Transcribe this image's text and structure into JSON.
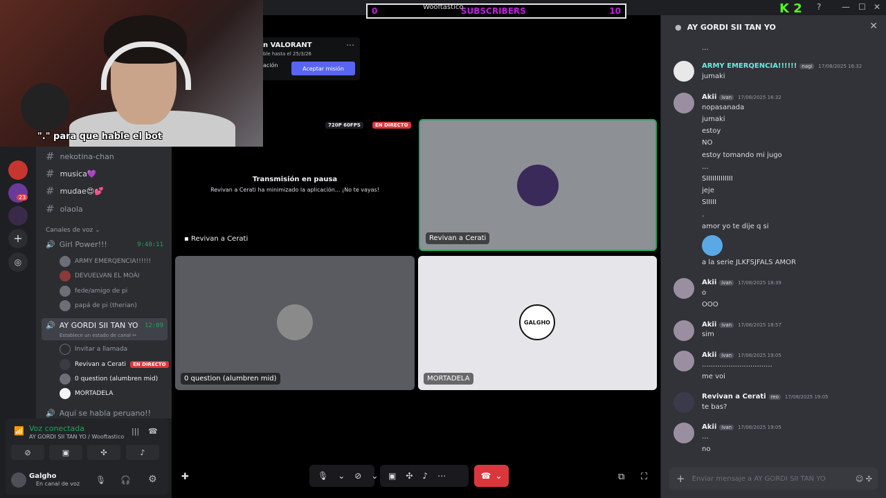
{
  "overlay": {
    "sub_left": "0",
    "sub_label": "SUBSCRIBERS",
    "sub_right": "10",
    "sub_who": "Wooftastico",
    "kick_count": "2",
    "cam_caption": "\".\" para que hable el bot"
  },
  "quest": {
    "title": "n VALORANT",
    "subtitle": "ble hasta el 25/3/26",
    "left_btn": "ación",
    "accept_btn": "Aceptar misión"
  },
  "channels": {
    "text": [
      {
        "label": "nekotina-chan"
      },
      {
        "label": "musica💜"
      },
      {
        "label": "mudae😍💕"
      },
      {
        "label": "olaola"
      }
    ],
    "voice_category": "Canales de voz ⌄",
    "voice1": {
      "name": "Girl Power!!!",
      "time": "9:48:11"
    },
    "voice1_users": [
      "ARMY EMERQENCIA!!!!!!",
      "DEVUELVAN EL MOÁI",
      "fede/amigo de pi",
      "papá de pi (therian)"
    ],
    "voice2": {
      "name": "AY GORDI SII TAN YO",
      "time": "12:09",
      "status": "Establece un estado de canal ✏"
    },
    "voice2_invite": "Invitar a llamada",
    "voice2_users": [
      "Revivan a Cerati",
      "0 question (alumbren mid)",
      "MORTADELA"
    ],
    "voice2_live": "EN DIRECTO",
    "voice3": "Aquí se habla peruano!!",
    "server_badge": "23"
  },
  "user_panel": {
    "voice_status": "Voz conectada",
    "voice_sub": "AY GORDI SII TAN YO / Wooftastico",
    "username": "Galgho",
    "user_status": "En canal de voz"
  },
  "stage": {
    "stream_quality": "720P 60FPS",
    "live_label": "EN DIRECTO",
    "paused_title": "Transmisión en pausa",
    "paused_text": "Revivan a Cerati ha minimizado la aplicación... ¡No te vayas!",
    "tiles": [
      {
        "name": "Revivan a Cerati"
      },
      {
        "name": "Revivan a Cerati"
      },
      {
        "name": "0 question (alumbren mid)"
      },
      {
        "name": "MORTADELA"
      }
    ],
    "galgho_logo": "GALGHO"
  },
  "chat": {
    "title": "AY GORDI SII TAN YO",
    "placeholder": "Enviar mensaje a AY GORDI SII TAN YO",
    "messages": [
      {
        "text": "..."
      },
      {
        "author": "ARMY EMERQENCIA!!!!!!",
        "tag": "nagi",
        "time": "17/08/2025 16:32",
        "lines": [
          "jumaki"
        ]
      },
      {
        "author": "Akii",
        "tag": "ivan",
        "time": "17/08/2025 16:32",
        "lines": [
          "nopasanada",
          "jumaki",
          "estoy",
          "NO",
          "estoy tomando mi jugo",
          "...",
          "SIIIIIIIIIIIII",
          "jeje",
          "SIIIII",
          ".",
          "amor yo te dije q si",
          "a la serie JLKFSJFALS AMOR"
        ]
      },
      {
        "author": "Akii",
        "tag": "ivan",
        "time": "17/08/2025 18:39",
        "lines": [
          "o",
          "OOO"
        ]
      },
      {
        "author": "Akii",
        "tag": "ivan",
        "time": "17/08/2025 18:57",
        "lines": [
          "sim"
        ]
      },
      {
        "author": "Akii",
        "tag": "ivan",
        "time": "17/08/2025 19:05",
        "lines": [
          "................................",
          "me voi"
        ]
      },
      {
        "author": "Revivan a Cerati",
        "tag": "reo",
        "time": "17/08/2025 19:05",
        "lines": [
          "te bas?"
        ]
      },
      {
        "author": "Akii",
        "tag": "ivan",
        "time": "17/08/2025 19:05",
        "lines": [
          "...",
          "no"
        ]
      }
    ]
  }
}
